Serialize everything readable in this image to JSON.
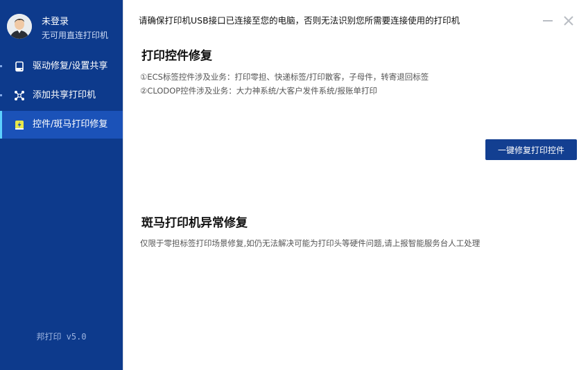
{
  "user": {
    "name": "未登录",
    "subtitle": "无可用直连打印机"
  },
  "sidebar": {
    "items": [
      {
        "label": "驱动修复/设置共享",
        "icon": "drive-icon",
        "active": false
      },
      {
        "label": "添加共享打印机",
        "icon": "network-icon",
        "active": false
      },
      {
        "label": "控件/斑马打印修复",
        "icon": "repair-icon",
        "active": true
      }
    ],
    "version": "邦打印 v5.0"
  },
  "main": {
    "notice": "请确保打印机USB接口已连接至您的电脑，否则无法识别您所需要连接使用的打印机",
    "sections": [
      {
        "title": "打印控件修复",
        "lines": [
          "①ECS标签控件涉及业务：打印零担、快递标签/打印散客，子母件，转寄退回标签",
          "②CLODOP控件涉及业务：大力神系统/大客户发件系统/报账单打印"
        ],
        "button": "一键修复打印控件"
      },
      {
        "title": "斑马打印机异常修复",
        "lines": [
          "仅限于零担标签打印场景修复,如仍无法解决可能为打印头等硬件问题,请上报智能服务台人工处理"
        ]
      }
    ]
  },
  "colors": {
    "sidebar_bg": "#0d3a8c",
    "active_bg": "#1b52b8",
    "active_indicator": "#5cd0ff",
    "button_bg": "#133f91",
    "repair_icon": "#e8e84a"
  }
}
